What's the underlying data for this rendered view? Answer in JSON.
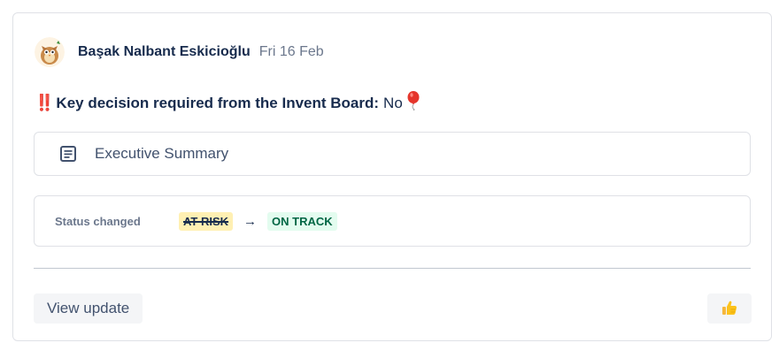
{
  "update": {
    "author": "Başak Nalbant Eskicioğlu",
    "date": "Fri 16 Feb",
    "decision": {
      "marker": "‼️",
      "label": "Key decision required from the Invent Board:",
      "value": "No",
      "emoji": "balloon"
    },
    "summary": {
      "label": "Executive Summary",
      "icon": "document-icon"
    },
    "status_change": {
      "label": "Status changed",
      "from": "AT RISK",
      "arrow": "→",
      "to": "ON TRACK"
    },
    "actions": {
      "view_label": "View update",
      "like_icon": "thumbs-up-icon"
    }
  },
  "colors": {
    "at_risk_bg": "#fff0b3",
    "on_track_bg": "#e3fcef",
    "on_track_text": "#006644",
    "decision_marker": "#de350b"
  }
}
